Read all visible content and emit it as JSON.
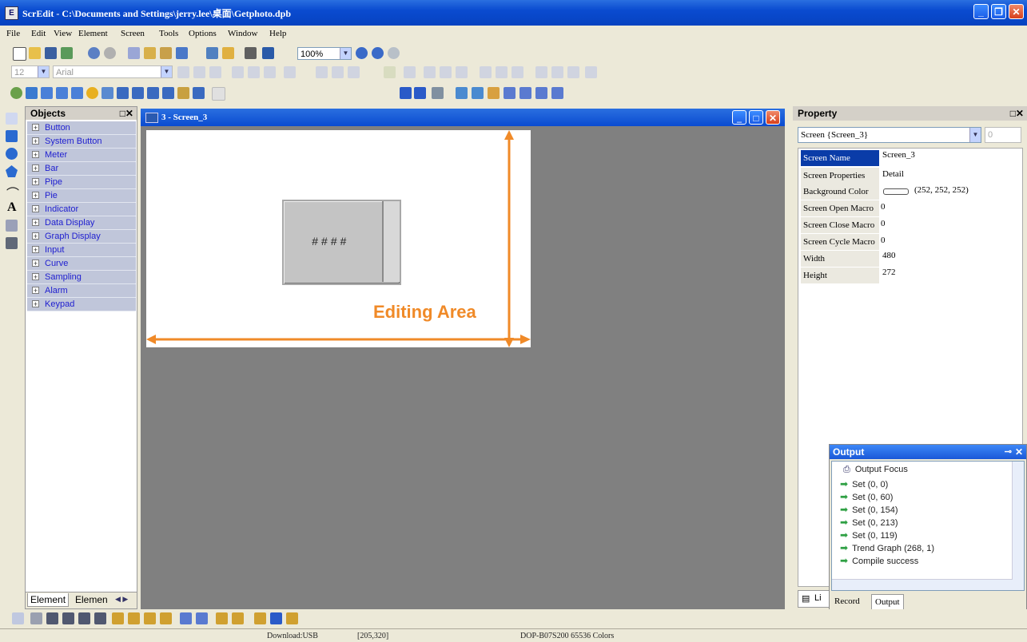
{
  "window": {
    "title": "ScrEdit - C:\\Documents and Settings\\jerry.lee\\桌面\\Getphoto.dpb",
    "app_icon": "E"
  },
  "menu": [
    "File",
    "Edit",
    "View",
    "Element",
    "Screen",
    "Tools",
    "Options",
    "Window",
    "Help"
  ],
  "toolbar": {
    "zoom_value": "100%",
    "font_size": "12",
    "font_name": "Arial"
  },
  "objects_panel": {
    "title": "Objects",
    "items": [
      "Button",
      "System Button",
      "Meter",
      "Bar",
      "Pipe",
      "Pie",
      "Indicator",
      "Data Display",
      "Graph Display",
      "Input",
      "Curve",
      "Sampling",
      "Alarm",
      "Keypad"
    ],
    "tabs": [
      "Element",
      "Elemen"
    ]
  },
  "editor": {
    "title": "3 - Screen_3",
    "widget_text": "####",
    "annotation": "Editing Area"
  },
  "property_panel": {
    "title": "Property",
    "selector": "Screen {Screen_3}",
    "selector_right": "0",
    "rows": [
      {
        "key": "Screen Name",
        "value": "Screen_3"
      },
      {
        "key": "Screen Properties",
        "value": "Detail"
      },
      {
        "key": "Background Color",
        "value": "(252, 252, 252)"
      },
      {
        "key": "Screen Open Macro",
        "value": "0"
      },
      {
        "key": "Screen Close Macro",
        "value": "0"
      },
      {
        "key": "Screen Cycle Macro",
        "value": "0"
      },
      {
        "key": "Width",
        "value": "480"
      },
      {
        "key": "Height",
        "value": "272"
      }
    ],
    "bottom_tab": "Li"
  },
  "output_panel": {
    "title": "Output",
    "focus_label": "Output Focus",
    "lines": [
      "Set (0, 0)",
      "Set (0, 60)",
      "Set (0, 154)",
      "Set (0, 213)",
      "Set (0, 119)",
      "Trend Graph (268, 1)",
      "Compile success"
    ],
    "tabs": [
      "Record",
      "Output"
    ]
  },
  "status_bar": {
    "download": "Download:USB",
    "coords": "[205,320]",
    "device": "DOP-B07S200 65536 Colors"
  },
  "colors": {
    "title_blue": "#0a4bd0",
    "canvas_bg": "#808080",
    "annotation_orange": "#f08a28",
    "object_item_bg": "#c0c6da"
  }
}
